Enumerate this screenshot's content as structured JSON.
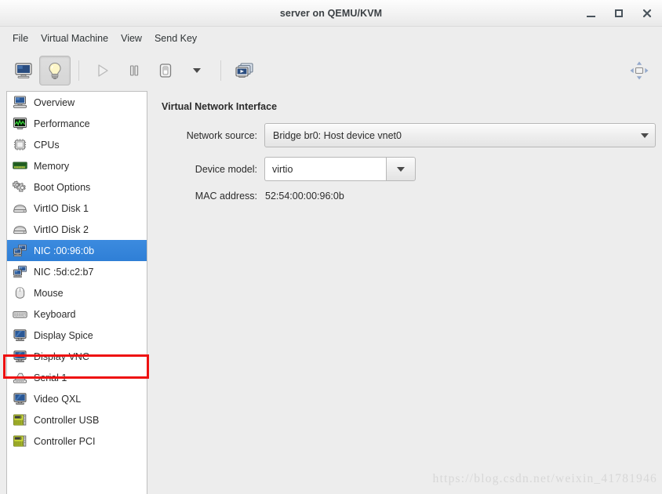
{
  "window": {
    "title": "server on QEMU/KVM",
    "controls": [
      {
        "name": "minimize",
        "label": "–"
      },
      {
        "name": "maximize",
        "label": "□"
      },
      {
        "name": "close",
        "label": "✕"
      }
    ]
  },
  "menubar": {
    "items": [
      {
        "label": "File"
      },
      {
        "label": "Virtual Machine"
      },
      {
        "label": "View"
      },
      {
        "label": "Send Key"
      }
    ]
  },
  "toolbar": {
    "buttons": [
      {
        "name": "show-console-view",
        "icon": "monitor-icon",
        "pressed": false,
        "enabled": true
      },
      {
        "name": "show-details-view",
        "icon": "lightbulb-icon",
        "pressed": true,
        "enabled": true
      },
      {
        "name": "run-vm",
        "icon": "play-icon",
        "pressed": false,
        "enabled": false
      },
      {
        "name": "pause-vm",
        "icon": "pause-icon",
        "pressed": false,
        "enabled": true
      },
      {
        "name": "shutdown-vm",
        "icon": "power-switch-icon",
        "pressed": false,
        "enabled": true
      },
      {
        "name": "shutdown-menu",
        "icon": "chevron-down-icon",
        "pressed": false,
        "enabled": true
      },
      {
        "name": "manage-snapshots",
        "icon": "snapshots-icon",
        "pressed": false,
        "enabled": true
      }
    ],
    "right_button": {
      "name": "resize-to-vm",
      "icon": "resize-arrows-icon"
    }
  },
  "sidebar": {
    "items": [
      {
        "label": "Overview",
        "icon": "computer-icon",
        "selected": false,
        "annotated": false
      },
      {
        "label": "Performance",
        "icon": "graph-icon",
        "selected": false,
        "annotated": false
      },
      {
        "label": "CPUs",
        "icon": "cpu-chip-icon",
        "selected": false,
        "annotated": false
      },
      {
        "label": "Memory",
        "icon": "memory-icon",
        "selected": false,
        "annotated": false
      },
      {
        "label": "Boot Options",
        "icon": "gears-icon",
        "selected": false,
        "annotated": false
      },
      {
        "label": "VirtIO Disk 1",
        "icon": "harddisk-icon",
        "selected": false,
        "annotated": false
      },
      {
        "label": "VirtIO Disk 2",
        "icon": "harddisk-icon",
        "selected": false,
        "annotated": false
      },
      {
        "label": "NIC :00:96:0b",
        "icon": "network-icon",
        "selected": true,
        "annotated": false
      },
      {
        "label": "NIC :5d:c2:b7",
        "icon": "network-icon",
        "selected": false,
        "annotated": true
      },
      {
        "label": "Mouse",
        "icon": "mouse-icon",
        "selected": false,
        "annotated": false
      },
      {
        "label": "Keyboard",
        "icon": "keyboard-icon",
        "selected": false,
        "annotated": false
      },
      {
        "label": "Display Spice",
        "icon": "display-icon",
        "selected": false,
        "annotated": false
      },
      {
        "label": "Display VNC",
        "icon": "display-icon",
        "selected": false,
        "annotated": false
      },
      {
        "label": "Serial 1",
        "icon": "serial-icon",
        "selected": false,
        "annotated": false
      },
      {
        "label": "Video QXL",
        "icon": "display-icon",
        "selected": false,
        "annotated": false
      },
      {
        "label": "Controller USB",
        "icon": "pci-card-icon",
        "selected": false,
        "annotated": false
      },
      {
        "label": "Controller PCI",
        "icon": "pci-card-icon",
        "selected": false,
        "annotated": false
      }
    ]
  },
  "details": {
    "section_title": "Virtual Network Interface",
    "network_source": {
      "label": "Network source:",
      "value": "Bridge br0: Host device vnet0"
    },
    "device_model": {
      "label": "Device model:",
      "value": "virtio"
    },
    "mac_address": {
      "label": "MAC address:",
      "value": "52:54:00:00:96:0b"
    }
  },
  "watermark": {
    "text": "https://blog.csdn.net/weixin_41781946"
  },
  "colors": {
    "selection_blue": "#307fd6",
    "annotation_red": "#ee1111",
    "window_bg": "#ededed",
    "list_bg": "#ffffff"
  }
}
